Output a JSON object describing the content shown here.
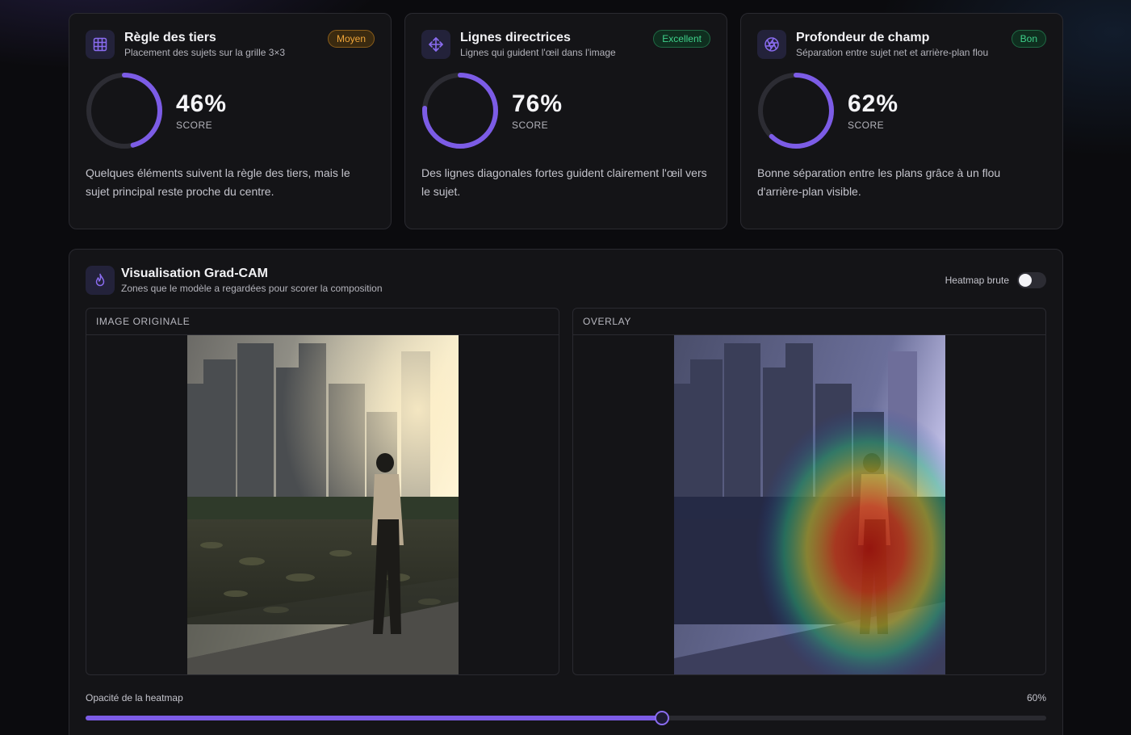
{
  "metrics": [
    {
      "title": "Règle des tiers",
      "subtitle": "Placement des sujets sur la grille 3×3",
      "badge": "Moyen",
      "score_text": "46%",
      "score": 46,
      "score_label": "SCORE",
      "description": "Quelques éléments suivent la règle des tiers, mais le sujet principal reste proche du centre.",
      "icon": "grid-icon"
    },
    {
      "title": "Lignes directrices",
      "subtitle": "Lignes qui guident l'œil dans l'image",
      "badge": "Excellent",
      "score_text": "76%",
      "score": 76,
      "score_label": "SCORE",
      "description": "Des lignes diagonales fortes guident clairement l'œil vers le sujet.",
      "icon": "move-arrows-icon"
    },
    {
      "title": "Profondeur de champ",
      "subtitle": "Séparation entre sujet net et arrière-plan flou",
      "badge": "Bon",
      "score_text": "62%",
      "score": 62,
      "score_label": "SCORE",
      "description": "Bonne séparation entre les plans grâce à un flou d'arrière-plan visible.",
      "icon": "aperture-icon"
    }
  ],
  "gradcam": {
    "title": "Visualisation Grad-CAM",
    "subtitle": "Zones que le modèle a regardées pour scorer la composition",
    "icon": "flame-icon",
    "toggle_label": "Heatmap brute",
    "toggle_on": false,
    "panel_original": "IMAGE ORIGINALE",
    "panel_overlay": "OVERLAY",
    "slider_label": "Opacité de la heatmap",
    "slider_value_text": "60%",
    "slider_value": 60
  },
  "colors": {
    "accent": "#7c5ce6",
    "ring_track": "#2c2c33",
    "badge_moyen": "#f0a63a",
    "badge_good": "#3fd08a"
  }
}
